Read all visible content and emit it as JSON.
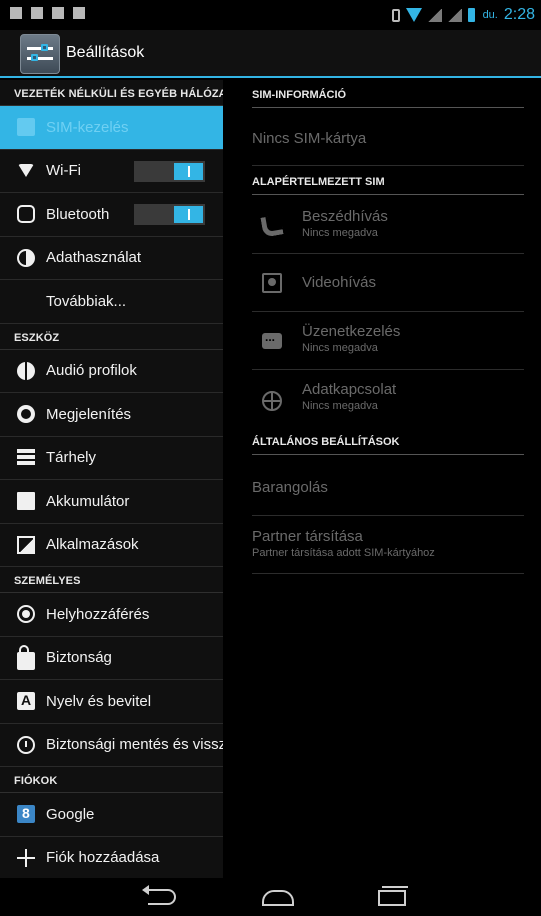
{
  "statusbar": {
    "ampm": "du.",
    "time": "2:28"
  },
  "actionbar": {
    "title": "Beállítások"
  },
  "sidebar": {
    "sections": {
      "wireless": "VEZETÉK NÉLKÜLI ÉS EGYÉB HÁLÓZATOK",
      "device": "ESZKÖZ",
      "personal": "SZEMÉLYES",
      "accounts": "FIÓKOK"
    },
    "items": {
      "sim": "SIM-kezelés",
      "wifi": "Wi-Fi",
      "bluetooth": "Bluetooth",
      "data": "Adathasználat",
      "more": "Továbbiak...",
      "audio": "Audió profilok",
      "display": "Megjelenítés",
      "storage": "Tárhely",
      "battery": "Akkumulátor",
      "apps": "Alkalmazások",
      "location": "Helyhozzáférés",
      "security": "Biztonság",
      "language": "Nyelv és bevitel",
      "backup": "Biztonsági mentés és visszaállítás",
      "google": "Google",
      "add_account": "Fiók hozzáadása"
    },
    "toggles": {
      "wifi": "on",
      "bluetooth": "on"
    }
  },
  "detail": {
    "sim_info_header": "SIM-INFORMÁCIÓ",
    "no_sim": "Nincs SIM-kártya",
    "default_sim_header": "ALAPÉRTELMEZETT SIM",
    "voice_call": {
      "title": "Beszédhívás",
      "subtitle": "Nincs megadva"
    },
    "video_call": {
      "title": "Videohívás"
    },
    "messaging": {
      "title": "Üzenetkezelés",
      "subtitle": "Nincs megadva"
    },
    "data_connection": {
      "title": "Adatkapcsolat",
      "subtitle": "Nincs megadva"
    },
    "general_header": "ÁLTALÁNOS BEÁLLÍTÁSOK",
    "roaming": {
      "title": "Barangolás"
    },
    "contact_binding": {
      "title": "Partner társítása",
      "subtitle": "Partner társítása adott SIM-kártyához"
    }
  },
  "colors": {
    "accent": "#33b5e5",
    "background": "#000000",
    "pane": "#101010",
    "disabled_text": "#6a6a6a"
  }
}
